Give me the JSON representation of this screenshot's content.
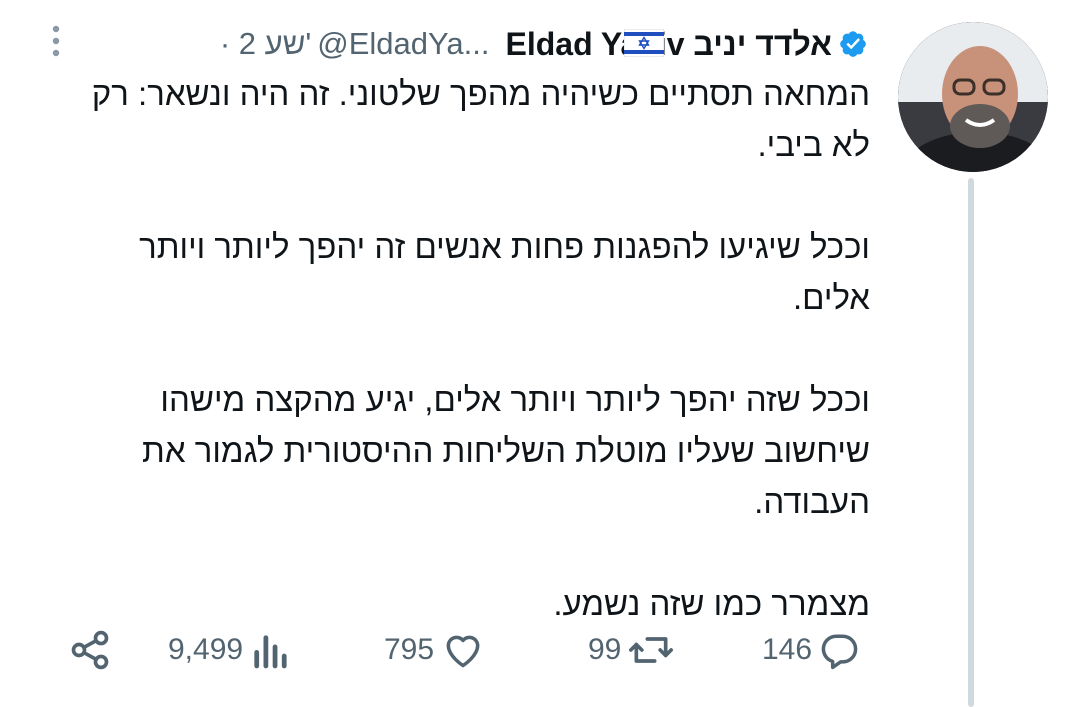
{
  "tweet": {
    "display_name": "Eldad Yaniv אלדד יניב",
    "handle": "@EldadYa...",
    "time": "· 2 שע'",
    "text": "המחאה תסתיים כשיהיה מהפך שלטוני. זה היה ונשאר: רק לא ביבי.\n\nוככל שיגיעו להפגנות פחות אנשים זה יהפך ליותר ויותר אלים.\n\nוככל שזה יהפך ליותר ויותר אלים, יגיע מהקצה מישהו שיחשוב שעליו מוטלת השליחות ההיסטורית לגמור את העבודה.\n\nמצמרר כמו שזה נשמע."
  },
  "icons": {
    "verified": "verified-badge-icon",
    "flag": "israel-flag-icon",
    "more": "more-vertical-icon",
    "reply": "reply-icon",
    "retweet": "retweet-icon",
    "like": "heart-icon",
    "views": "views-icon",
    "share": "share-icon"
  },
  "actions": {
    "reply_count": "146",
    "retweet_count": "99",
    "like_count": "795",
    "views_count": "9,499"
  },
  "colors": {
    "text": "#0f1419",
    "secondary": "#536471",
    "verified_blue": "#1d9bf0",
    "thread_line": "#cfd9de"
  }
}
